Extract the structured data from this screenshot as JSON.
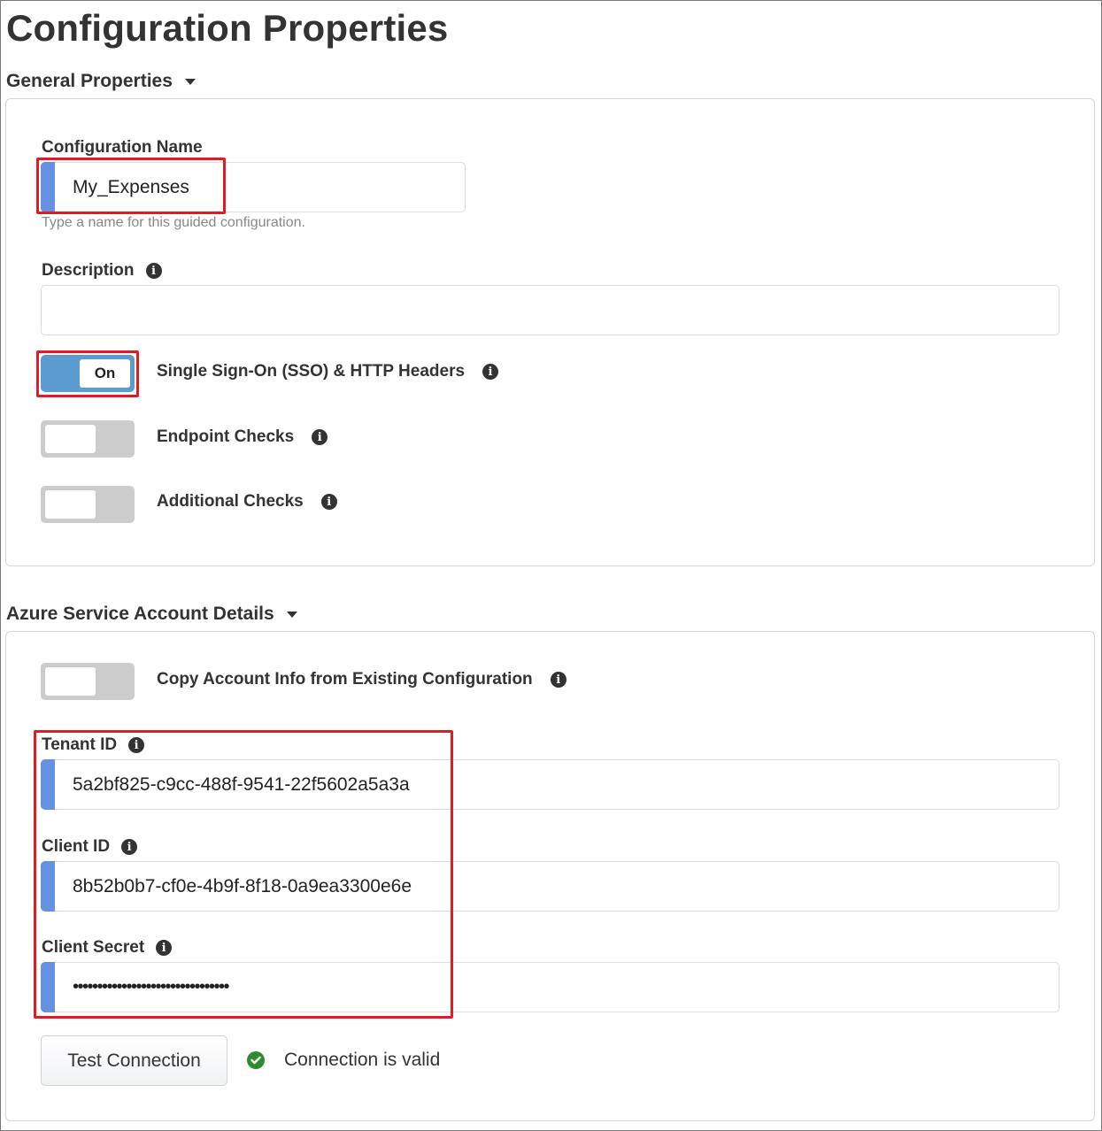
{
  "page": {
    "title": "Configuration Properties"
  },
  "general": {
    "header": "General Properties",
    "config_name": {
      "label": "Configuration Name",
      "value": "My_Expenses",
      "helper": "Type a name for this guided configuration."
    },
    "description": {
      "label": "Description",
      "value": ""
    },
    "toggles": [
      {
        "label": "Single Sign-On (SSO) & HTTP Headers",
        "state": "on",
        "knob_text": "On"
      },
      {
        "label": "Endpoint Checks",
        "state": "off",
        "knob_text": ""
      },
      {
        "label": "Additional Checks",
        "state": "off",
        "knob_text": ""
      }
    ]
  },
  "azure": {
    "header": "Azure Service Account Details",
    "copy_toggle": {
      "label": "Copy Account Info from Existing Configuration",
      "state": "off"
    },
    "tenant_id": {
      "label": "Tenant ID",
      "value": "5a2bf825-c9cc-488f-9541-22f5602a5a3a"
    },
    "client_id": {
      "label": "Client ID",
      "value": "8b52b0b7-cf0e-4b9f-8f18-0a9ea3300e6e"
    },
    "client_secret": {
      "label": "Client Secret",
      "value": "••••••••••••••••••••••••••••••••"
    },
    "test_button": "Test Connection",
    "status_text": "Connection is valid"
  },
  "icons": {
    "info": "i",
    "caret": "caret-down",
    "check": "check-circle"
  },
  "colors": {
    "accent_blue": "#6690e0",
    "toggle_on": "#5b9bd0",
    "toggle_off": "#cccccc",
    "highlight_red": "#e01b24",
    "success_green": "#2e8b2e"
  }
}
